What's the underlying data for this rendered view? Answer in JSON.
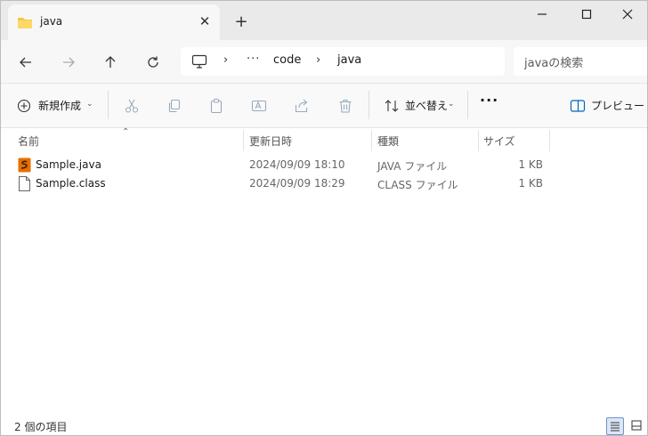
{
  "tab": {
    "title": "java",
    "close_glyph": "✕",
    "new_tab_glyph": "+",
    "icon": "folder-icon"
  },
  "window_controls": [
    "minimize",
    "maximize",
    "close"
  ],
  "nav": {
    "buttons": [
      "back",
      "forward",
      "up",
      "refresh"
    ]
  },
  "address": {
    "items": [
      "code",
      "java"
    ],
    "overflow": "···",
    "root_icon": "this-pc-icon"
  },
  "search": {
    "placeholder": "javaの検索"
  },
  "toolbar": {
    "new_label": "新規作成",
    "actions": [
      "cut",
      "copy",
      "paste",
      "rename",
      "share",
      "delete"
    ],
    "sort_label": "並べ替え",
    "more_label": "···",
    "preview_label": "プレビュー"
  },
  "columns": {
    "name": "名前",
    "date": "更新日時",
    "type": "種類",
    "size": "サイズ"
  },
  "files": [
    {
      "name": "Sample.java",
      "date": "2024/09/09 18:10",
      "type": "JAVA ファイル",
      "size": "1 KB",
      "icon": "java-file-icon"
    },
    {
      "name": "Sample.class",
      "date": "2024/09/09 18:29",
      "type": "CLASS ファイル",
      "size": "1 KB",
      "icon": "generic-file-icon"
    }
  ],
  "status": {
    "item_count": "2 個の項目"
  },
  "colors": {
    "accent": "#0067c0",
    "folder": "#f4c842",
    "java_icon": "#e76f00"
  }
}
